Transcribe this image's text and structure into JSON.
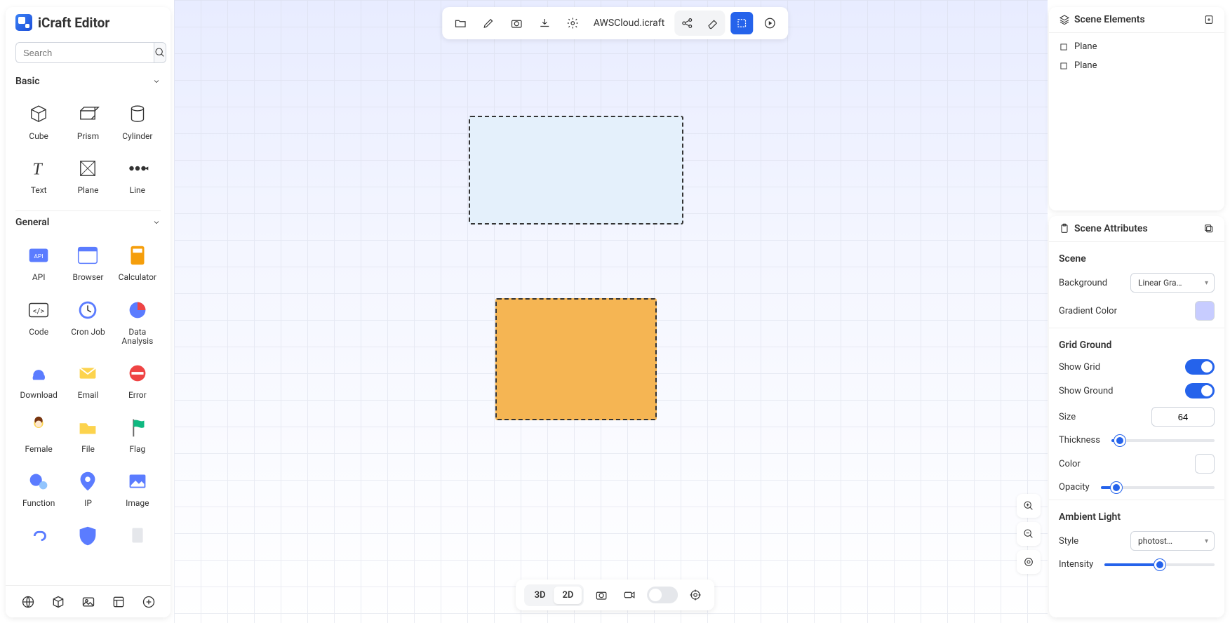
{
  "app": {
    "title": "iCraft Editor"
  },
  "search": {
    "placeholder": "Search"
  },
  "categories": {
    "basic": {
      "label": "Basic",
      "items": [
        "Cube",
        "Prism",
        "Cylinder",
        "Text",
        "Plane",
        "Line"
      ]
    },
    "general": {
      "label": "General",
      "items": [
        "API",
        "Browser",
        "Calculator",
        "Code",
        "Cron Job",
        "Data Analysis",
        "Download",
        "Email",
        "Error",
        "Female",
        "File",
        "Flag",
        "Function",
        "IP",
        "Image"
      ]
    }
  },
  "file": {
    "name": "AWSCloud.icraft"
  },
  "view": {
    "mode_3d": "3D",
    "mode_2d": "2D"
  },
  "elements_panel": {
    "title": "Scene Elements",
    "items": [
      "Plane",
      "Plane"
    ]
  },
  "attrs_panel": {
    "title": "Scene Attributes",
    "scene": {
      "heading": "Scene",
      "background_label": "Background",
      "background_value": "Linear Gra…",
      "gradient_color_label": "Gradient Color",
      "gradient_color": "#c7ccff"
    },
    "grid": {
      "heading": "Grid Ground",
      "show_grid_label": "Show Grid",
      "show_grid": true,
      "show_ground_label": "Show Ground",
      "show_ground": true,
      "size_label": "Size",
      "size": "64",
      "thickness_label": "Thickness",
      "thickness_pct": 8,
      "color_label": "Color",
      "color": "#ffffff",
      "opacity_label": "Opacity",
      "opacity_pct": 14
    },
    "ambient": {
      "heading": "Ambient Light",
      "style_label": "Style",
      "style_value": "photost…",
      "intensity_label": "Intensity",
      "intensity_pct": 50
    }
  },
  "colors": {
    "shape1_fill": "#e4f0fb",
    "shape2_fill": "#f5b553"
  }
}
